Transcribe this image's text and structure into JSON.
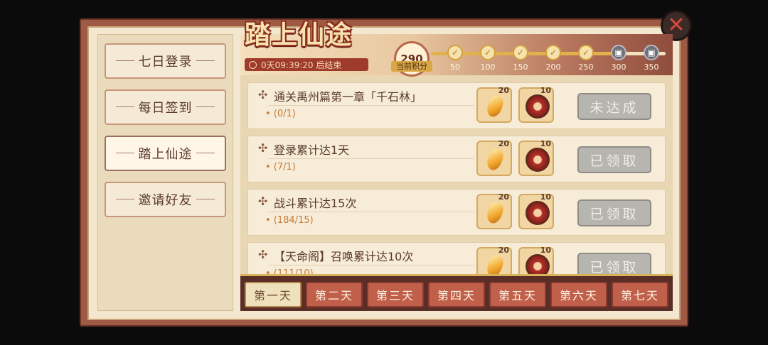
{
  "header": {
    "title": "踏上仙途",
    "timer": "0天09:39:20  后结束",
    "score": "290",
    "score_label": "当前积分",
    "progress_fraction": 0.83,
    "milestones": [
      {
        "value": "50",
        "state": "done"
      },
      {
        "value": "100",
        "state": "done"
      },
      {
        "value": "150",
        "state": "done"
      },
      {
        "value": "200",
        "state": "done"
      },
      {
        "value": "250",
        "state": "done"
      },
      {
        "value": "300",
        "state": "gift"
      },
      {
        "value": "350",
        "state": "gift"
      }
    ]
  },
  "sidebar": {
    "items": [
      {
        "label": "七日登录",
        "active": false
      },
      {
        "label": "每日签到",
        "active": false
      },
      {
        "label": "踏上仙途",
        "active": true
      },
      {
        "label": "邀请好友",
        "active": false
      }
    ]
  },
  "tasks": [
    {
      "name": "通关禹州篇第一章「千石林」",
      "progress": "• (0/1)",
      "reward1": "20",
      "reward2": "10",
      "button": "未达成"
    },
    {
      "name": "登录累计达1天",
      "progress": "• (7/1)",
      "reward1": "20",
      "reward2": "10",
      "button": "已领取"
    },
    {
      "name": "战斗累计达15次",
      "progress": "• (184/15)",
      "reward1": "20",
      "reward2": "10",
      "button": "已领取"
    },
    {
      "name": "【天命阁】召唤累计达10次",
      "progress": "• (111/10)",
      "reward1": "20",
      "reward2": "10",
      "button": "已领取"
    }
  ],
  "days": [
    "第一天",
    "第二天",
    "第三天",
    "第四天",
    "第五天",
    "第六天",
    "第七天"
  ],
  "selected_day_index": 0,
  "icons": {
    "close": "close-icon",
    "check": "check-icon",
    "gift": "gift-icon",
    "clock": "clock-icon"
  }
}
